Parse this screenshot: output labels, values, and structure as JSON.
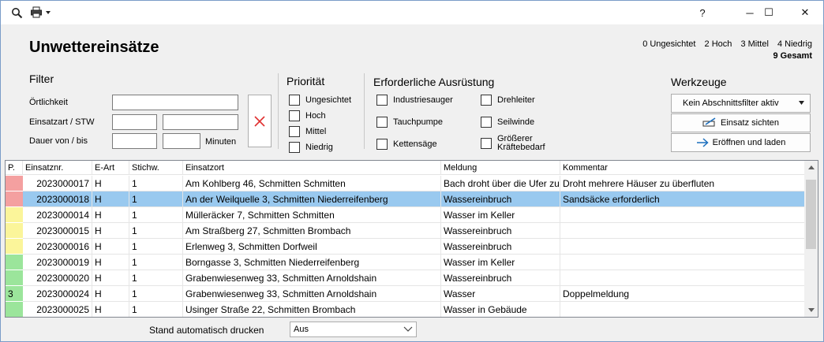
{
  "window": {
    "help_label": "?",
    "minimize_label": "─",
    "maximize_label": "☐",
    "close_label": "✕"
  },
  "page": {
    "title": "Unwettereinsätze"
  },
  "stats": {
    "unseen": "0 Ungesichtet",
    "high": "2 Hoch",
    "medium": "3 Mittel",
    "low": "4 Niedrig",
    "total": "9 Gesamt"
  },
  "filter": {
    "heading": "Filter",
    "location_label": "Örtlichkeit",
    "location_value": "",
    "type_label": "Einsatzart / STW",
    "type_value": "",
    "stw_value": "",
    "duration_label": "Dauer von / bis",
    "duration_from": "",
    "duration_to": "",
    "minutes_label": "Minuten"
  },
  "priority": {
    "heading": "Priorität",
    "options": [
      "Ungesichtet",
      "Hoch",
      "Mittel",
      "Niedrig"
    ]
  },
  "equipment": {
    "heading": "Erforderliche Ausrüstung",
    "options": [
      "Industriesauger",
      "Drehleiter",
      "Tauchpumpe",
      "Seilwinde",
      "Kettensäge",
      "Größerer",
      "Kräftebedarf"
    ]
  },
  "tools": {
    "heading": "Werkzeuge",
    "section_filter_value": "Kein Abschnittsfilter aktiv",
    "view_button": "Einsatz sichten",
    "open_button": "Eröffnen und laden"
  },
  "table": {
    "columns": [
      "P.",
      "Einsatznr.",
      "E-Art",
      "Stichw.",
      "Einsatzort",
      "Meldung",
      "Kommentar"
    ],
    "rows": [
      {
        "prio": "",
        "color": "#f4a0a0",
        "nr": "2023000017",
        "art": "H",
        "stichw": "1",
        "ort": "Am Kohlberg 46, Schmitten Schmitten",
        "meldung": "Bach droht über die Ufer zu",
        "kommentar": "Droht mehrere Häuser zu überfluten"
      },
      {
        "prio": "",
        "color": "#f4a0a0",
        "nr": "2023000018",
        "art": "H",
        "stichw": "1",
        "ort": "An der Weilquelle 3, Schmitten Niederreifenberg",
        "meldung": "Wassereinbruch",
        "kommentar": "Sandsäcke erforderlich"
      },
      {
        "prio": "",
        "color": "#fbf59a",
        "nr": "2023000014",
        "art": "H",
        "stichw": "1",
        "ort": "Mülleräcker 7, Schmitten Schmitten",
        "meldung": "Wasser im Keller",
        "kommentar": ""
      },
      {
        "prio": "",
        "color": "#fbf59a",
        "nr": "2023000015",
        "art": "H",
        "stichw": "1",
        "ort": "Am Straßberg 27, Schmitten Brombach",
        "meldung": "Wassereinbruch",
        "kommentar": ""
      },
      {
        "prio": "",
        "color": "#fbf59a",
        "nr": "2023000016",
        "art": "H",
        "stichw": "1",
        "ort": "Erlenweg 3, Schmitten Dorfweil",
        "meldung": "Wassereinbruch",
        "kommentar": ""
      },
      {
        "prio": "",
        "color": "#9be59b",
        "nr": "2023000019",
        "art": "H",
        "stichw": "1",
        "ort": "Borngasse 3, Schmitten Niederreifenberg",
        "meldung": "Wasser im Keller",
        "kommentar": ""
      },
      {
        "prio": "",
        "color": "#9be59b",
        "nr": "2023000020",
        "art": "H",
        "stichw": "1",
        "ort": "Grabenwiesenweg 33, Schmitten Arnoldshain",
        "meldung": "Wassereinbruch",
        "kommentar": ""
      },
      {
        "prio": "3",
        "color": "#9be59b",
        "nr": "2023000024",
        "art": "H",
        "stichw": "1",
        "ort": "Grabenwiesenweg 33, Schmitten Arnoldshain",
        "meldung": "Wasser",
        "kommentar": "Doppelmeldung"
      },
      {
        "prio": "",
        "color": "#9be59b",
        "nr": "2023000025",
        "art": "H",
        "stichw": "1",
        "ort": "Usinger Straße 22, Schmitten Brombach",
        "meldung": "Wasser in Gebäude",
        "kommentar": ""
      }
    ],
    "selected_row": 1
  },
  "footer": {
    "autoprint_label": "Stand automatisch drucken",
    "autoprint_value": "Aus"
  }
}
